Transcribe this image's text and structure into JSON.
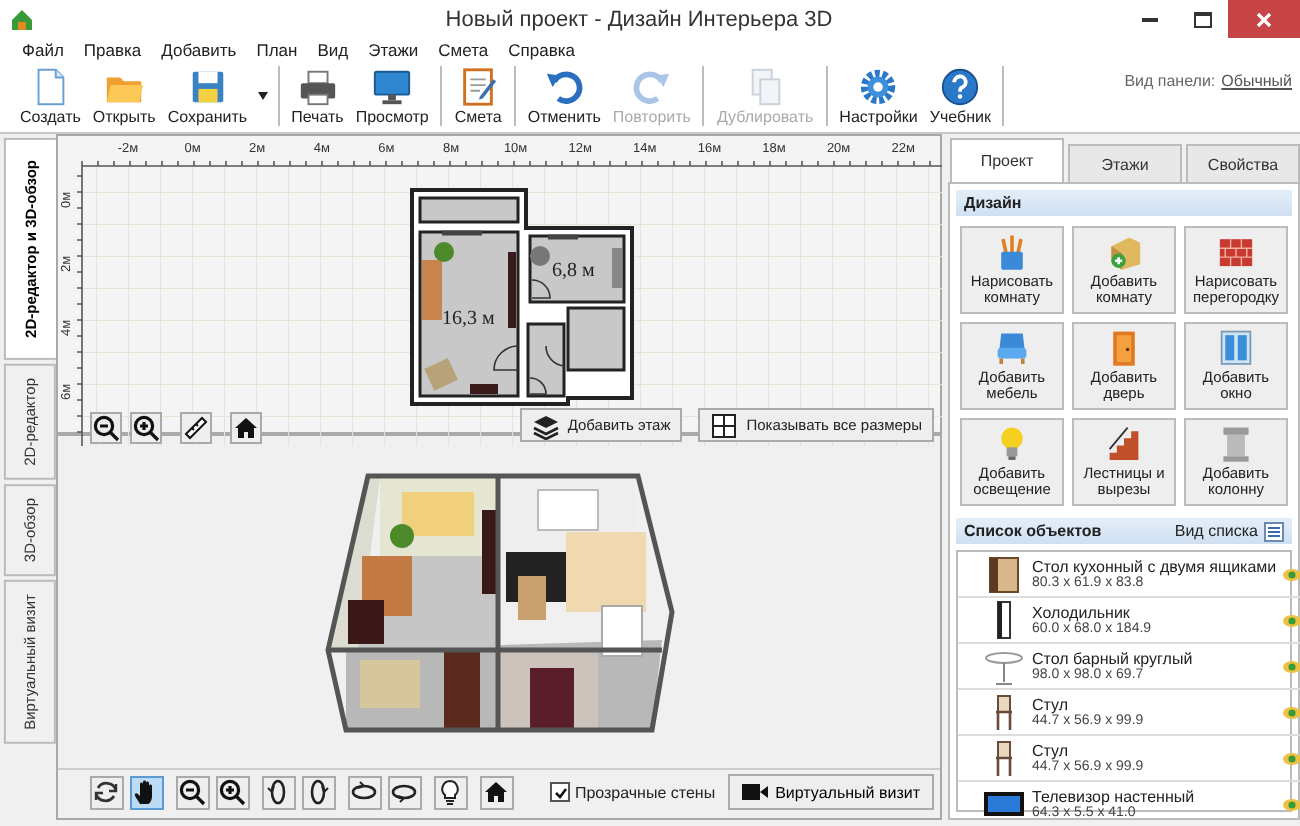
{
  "window": {
    "title": "Новый проект - Дизайн Интерьера 3D"
  },
  "menu": [
    "Файл",
    "Правка",
    "Добавить",
    "План",
    "Вид",
    "Этажи",
    "Смета",
    "Справка"
  ],
  "toolbar": {
    "groups": [
      [
        {
          "kind": "new",
          "label": "Создать",
          "disabled": false
        },
        {
          "kind": "open",
          "label": "Открыть",
          "disabled": false
        },
        {
          "kind": "save",
          "label": "Сохранить",
          "disabled": false
        },
        {
          "kind": "dropdown",
          "disabled": false
        }
      ],
      [
        {
          "kind": "print",
          "label": "Печать",
          "disabled": false
        },
        {
          "kind": "preview",
          "label": "Просмотр",
          "disabled": false
        }
      ],
      [
        {
          "kind": "estimate",
          "label": "Смета",
          "disabled": false
        }
      ],
      [
        {
          "kind": "undo",
          "label": "Отменить",
          "disabled": false
        },
        {
          "kind": "redo",
          "label": "Повторить",
          "disabled": true
        }
      ],
      [
        {
          "kind": "duplicate",
          "label": "Дублировать",
          "disabled": true
        }
      ],
      [
        {
          "kind": "settings",
          "label": "Настройки",
          "disabled": false
        },
        {
          "kind": "help",
          "label": "Учебник",
          "disabled": false
        }
      ]
    ],
    "panel_view": {
      "label": "Вид панели:",
      "value": "Обычный"
    }
  },
  "side_tabs": [
    {
      "label": "2D-редактор и 3D-обзор",
      "selected": true
    },
    {
      "label": "2D-редактор",
      "selected": false
    },
    {
      "label": "3D-обзор",
      "selected": false
    },
    {
      "label": "Виртуальный визит",
      "selected": false
    }
  ],
  "plan": {
    "ruler_x": [
      "-2м",
      "0м",
      "2м",
      "4м",
      "6м",
      "8м",
      "10м",
      "12м",
      "14м",
      "16м",
      "18м",
      "20м",
      "22м"
    ],
    "ruler_y": [
      "0м",
      "2м",
      "4м",
      "6м"
    ],
    "rooms": [
      {
        "area": "16,3 м"
      },
      {
        "area": "6,8 м"
      }
    ],
    "buttons": [
      {
        "kind": "add-floor",
        "label": "Добавить этаж"
      },
      {
        "kind": "dimensions",
        "label": "Показывать все размеры"
      }
    ]
  },
  "view3d": {
    "tool_groups": [
      [
        {
          "kind": "rotate",
          "selected": false
        },
        {
          "kind": "pan",
          "selected": true
        }
      ],
      [
        {
          "kind": "zoom-out",
          "selected": false
        },
        {
          "kind": "zoom-in",
          "selected": false
        }
      ],
      [
        {
          "kind": "orbit-left",
          "selected": false
        },
        {
          "kind": "orbit-right",
          "selected": false
        }
      ],
      [
        {
          "kind": "tilt-up",
          "selected": false
        },
        {
          "kind": "tilt-down",
          "selected": false
        }
      ],
      [
        {
          "kind": "light",
          "selected": false
        }
      ],
      [
        {
          "kind": "home",
          "selected": false
        }
      ]
    ],
    "transparent_walls": {
      "label": "Прозрачные стены",
      "checked": true
    },
    "visit_button": {
      "label": "Виртуальный визит"
    }
  },
  "right_panel": {
    "tabs": [
      {
        "label": "Проект",
        "selected": true
      },
      {
        "label": "Этажи",
        "selected": false
      },
      {
        "label": "Свойства",
        "selected": false
      }
    ],
    "design": {
      "title": "Дизайн",
      "buttons": [
        {
          "kind": "draw-room",
          "label": "Нарисовать комнату"
        },
        {
          "kind": "add-room",
          "label": "Добавить комнату"
        },
        {
          "kind": "partition",
          "label": "Нарисовать перегородку"
        },
        {
          "kind": "furniture",
          "label": "Добавить мебель"
        },
        {
          "kind": "door",
          "label": "Добавить дверь"
        },
        {
          "kind": "window",
          "label": "Добавить окно"
        },
        {
          "kind": "light",
          "label": "Добавить освещение"
        },
        {
          "kind": "stairs",
          "label": "Лестницы и вырезы"
        },
        {
          "kind": "column",
          "label": "Добавить колонну"
        }
      ]
    },
    "objects": {
      "title": "Список объектов",
      "view_label": "Вид списка",
      "items": [
        {
          "kind": "cabinet",
          "name": "Стол кухонный с двумя ящиками",
          "size": "80.3 x 61.9 x 83.8",
          "visible": true
        },
        {
          "kind": "fridge",
          "name": "Холодильник",
          "size": "60.0 x 68.0 x 184.9",
          "visible": true
        },
        {
          "kind": "round-table",
          "name": "Стол барный круглый",
          "size": "98.0 x 98.0 x 69.7",
          "visible": true
        },
        {
          "kind": "chair",
          "name": "Стул",
          "size": "44.7 x 56.9 x 99.9",
          "visible": true
        },
        {
          "kind": "chair",
          "name": "Стул",
          "size": "44.7 x 56.9 x 99.9",
          "visible": true
        },
        {
          "kind": "tv",
          "name": "Телевизор настенный",
          "size": "64.3 x 5.5 x 41.0",
          "visible": true
        }
      ]
    }
  }
}
